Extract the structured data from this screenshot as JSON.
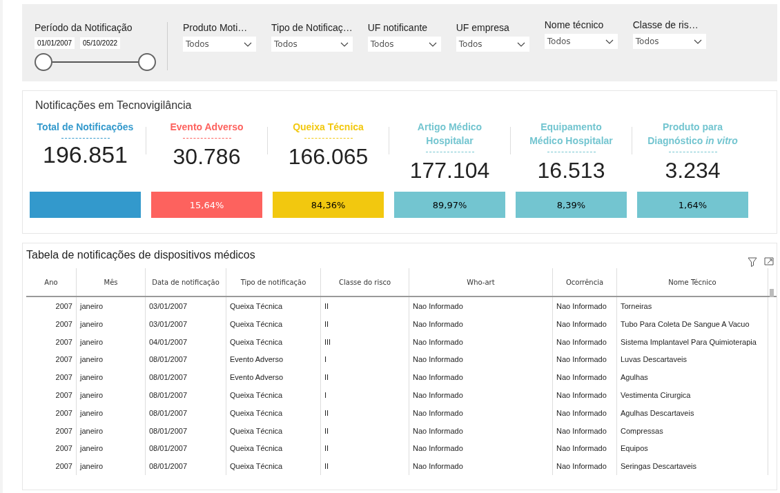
{
  "filters": {
    "period": {
      "label": "Período da Notificação",
      "start": "01/01/2007",
      "end": "05/10/2022",
      "level": 1
    },
    "dropdowns": [
      {
        "label": "Produto Moti…",
        "value": "Todos"
      },
      {
        "label": "Tipo de Notificaç…",
        "value": "Todos"
      },
      {
        "label": "UF notificante",
        "value": "Todos"
      },
      {
        "label": "UF empresa",
        "value": "Todos"
      },
      {
        "label": "Nome técnico",
        "value": "Todos"
      },
      {
        "label": "Classe de ris…",
        "value": "Todos"
      }
    ]
  },
  "kpis": {
    "title": "Notificações em Tecnovigilância",
    "cards": [
      {
        "title": "Total de Notificações",
        "value": "196.851",
        "color": "#3399cc"
      },
      {
        "title": "Evento Adverso",
        "value": "30.786",
        "color": "#fd625e",
        "percent": "15,64%"
      },
      {
        "title": "Queixa Técnica",
        "value": "166.065",
        "color": "#f2c80f",
        "percent": "84,36%"
      },
      {
        "title": "Artigo Médico Hospitalar",
        "value": "177.104",
        "color": "#73c5d0",
        "percent": "89,97%"
      },
      {
        "title": "Equipamento Médico Hospitalar",
        "value": "16.513",
        "color": "#73c5d0",
        "percent": "8,39%"
      },
      {
        "title": "Produto para Diagnóstico *in vitro*",
        "value": "3.234",
        "color": "#73c5d0",
        "percent": "1,64%"
      }
    ]
  },
  "table": {
    "title": "Tabela de notificações de dispositivos médicos",
    "columns": [
      "Ano",
      "Mês",
      "Data de notificação",
      "Tipo de notificação",
      "Classe do risco",
      "Who-art",
      "Ocorrência",
      "Nome Técnico"
    ],
    "rows": [
      [
        "2007",
        "janeiro",
        "03/01/2007",
        "Queixa Técnica",
        "II",
        "Nao Informado",
        "Nao Informado",
        "Torneiras"
      ],
      [
        "2007",
        "janeiro",
        "03/01/2007",
        "Queixa Técnica",
        "II",
        "Nao Informado",
        "Nao Informado",
        "Tubo Para Coleta De Sangue A Vacuo"
      ],
      [
        "2007",
        "janeiro",
        "04/01/2007",
        "Queixa Técnica",
        "III",
        "Nao Informado",
        "Nao Informado",
        "Sistema Implantavel Para Quimioterapia"
      ],
      [
        "2007",
        "janeiro",
        "08/01/2007",
        "Evento Adverso",
        "I",
        "Nao Informado",
        "Nao Informado",
        "Luvas Descartaveis"
      ],
      [
        "2007",
        "janeiro",
        "08/01/2007",
        "Evento Adverso",
        "II",
        "Nao Informado",
        "Nao Informado",
        "Agulhas"
      ],
      [
        "2007",
        "janeiro",
        "08/01/2007",
        "Queixa Técnica",
        "I",
        "Nao Informado",
        "Nao Informado",
        "Vestimenta Cirurgica"
      ],
      [
        "2007",
        "janeiro",
        "08/01/2007",
        "Queixa Técnica",
        "II",
        "Nao Informado",
        "Nao Informado",
        "Agulhas Descartaveis"
      ],
      [
        "2007",
        "janeiro",
        "08/01/2007",
        "Queixa Técnica",
        "II",
        "Nao Informado",
        "Nao Informado",
        "Compressas"
      ],
      [
        "2007",
        "janeiro",
        "08/01/2007",
        "Queixa Técnica",
        "II",
        "Nao Informado",
        "Nao Informado",
        "Equipos"
      ],
      [
        "2007",
        "janeiro",
        "08/01/2007",
        "Queixa Técnica",
        "II",
        "Nao Informado",
        "Nao Informado",
        "Seringas Descartaveis"
      ]
    ]
  }
}
